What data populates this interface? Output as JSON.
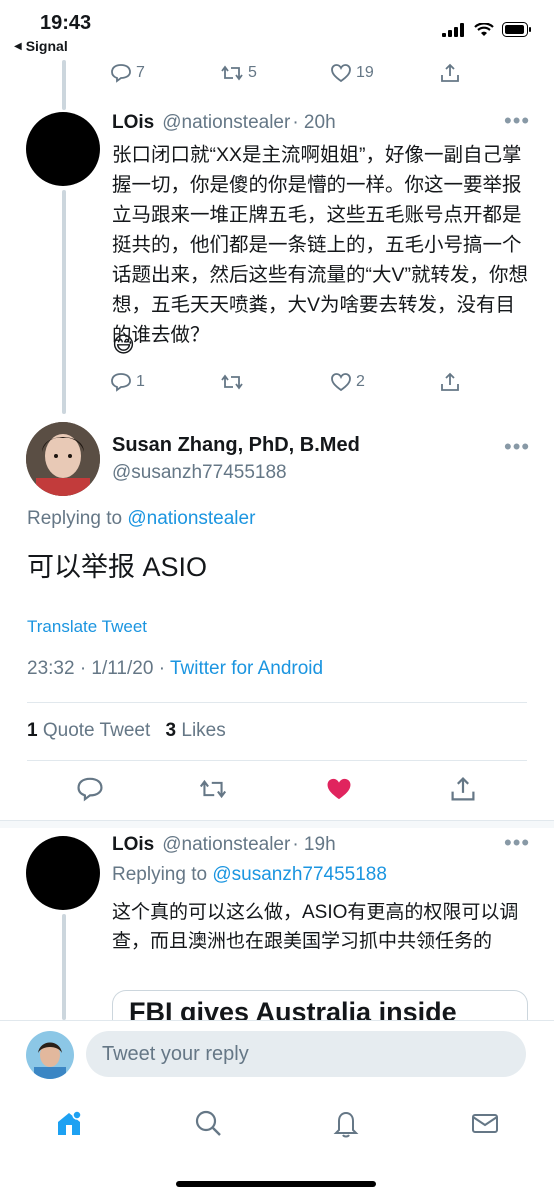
{
  "status": {
    "time": "19:43",
    "back_label": "Signal"
  },
  "top_tweet_actions": {
    "reply_count": "7",
    "retweet_count": "5",
    "like_count": "19"
  },
  "tweet1": {
    "name": "LOis",
    "handle": "@nationstealer",
    "time": "· 20h",
    "text": "张口闭口就“XX是主流啊姐姐”，好像一副自己掌握一切，你是傻的你是懵的一样。你这一要举报立马跟来一堆正牌五毛，这些五毛账号点开都是挺共的，他们都是一条链上的，五毛小号搞一个话题出来，然后这些有流量的“大V”就转发，你想想，五毛天天喷粪，大V为啥要去转发，没有目的谁去做？",
    "emoji": "😅",
    "reply_count": "1",
    "retweet_count": "",
    "like_count": "2"
  },
  "main_tweet": {
    "name": "Susan Zhang, PhD, B.Med",
    "handle": "@susanzh77455188",
    "replying_prefix": "Replying to",
    "replying_to": "@nationstealer",
    "text": "可以举报 ASIO",
    "translate": "Translate Tweet",
    "timestamp": "23:32 · 1/11/20 ·",
    "source": "Twitter for Android",
    "quote_count": "1",
    "quote_label": "Quote Tweet",
    "like_count": "3",
    "like_label": "Likes"
  },
  "tweet2": {
    "name": "LOis",
    "handle": "@nationstealer",
    "time": "· 19h",
    "replying_prefix": "Replying to",
    "replying_to": "@susanzh77455188",
    "text": "这个真的可以这么做，ASIO有更高的权限可以调查，而且澳洲也在跟美国学习抓中共领任务的",
    "card_title": "FBI gives Australia inside"
  },
  "reply_box": {
    "placeholder": "Tweet your reply"
  },
  "nav": [
    "home-icon",
    "search-icon",
    "notifications-icon",
    "messages-icon"
  ],
  "colors": {
    "accent": "#1b95e0",
    "like": "#e0245e",
    "muted": "#657786"
  }
}
